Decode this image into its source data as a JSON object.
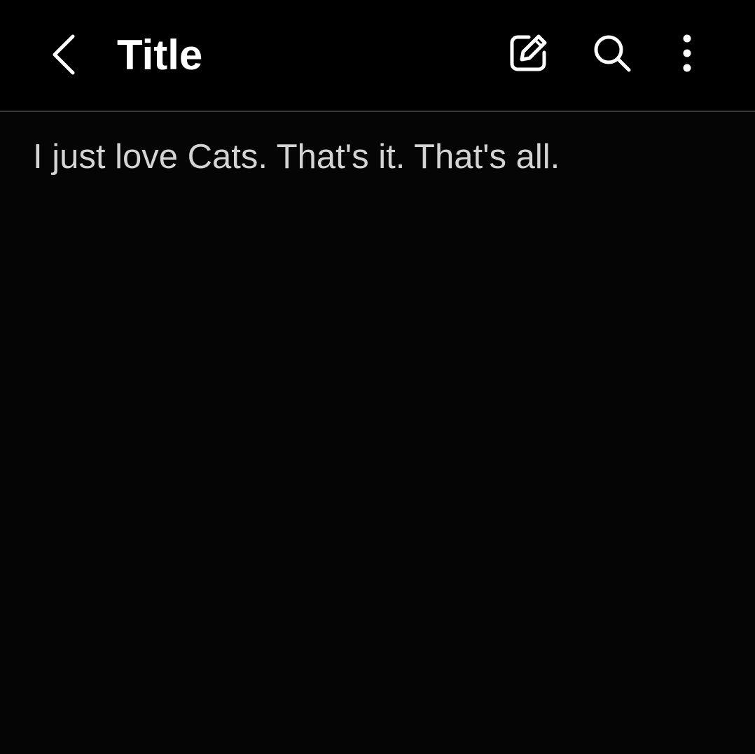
{
  "header": {
    "title": "Title",
    "icons": {
      "back": "back-arrow-icon",
      "edit": "edit-icon",
      "search": "search-icon",
      "more": "more-vert-icon"
    }
  },
  "note": {
    "body": "I just love Cats. That's it. That's all."
  },
  "colors": {
    "background": "#050505",
    "header_background": "#000000",
    "title_text": "#ffffff",
    "body_text": "#d4d4d4",
    "divider": "#3a3a3a"
  }
}
